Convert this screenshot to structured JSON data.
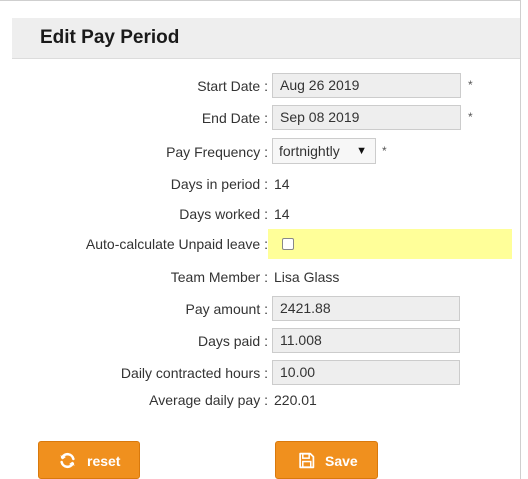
{
  "form": {
    "title": "Edit Pay Period",
    "start_date": {
      "label": "Start Date :",
      "value": "Aug 26 2019",
      "required": "*"
    },
    "end_date": {
      "label": "End Date :",
      "value": "Sep 08 2019",
      "required": "*"
    },
    "pay_frequency": {
      "label": "Pay Frequency :",
      "selected": "fortnightly",
      "required": "*"
    },
    "days_in_period": {
      "label": "Days in period :",
      "value": "14"
    },
    "days_worked": {
      "label": "Days worked :",
      "value": "14"
    },
    "auto_calculate": {
      "label": "Auto-calculate Unpaid leave :",
      "checked": false
    },
    "team_member": {
      "label": "Team Member :",
      "value": "Lisa Glass"
    },
    "pay_amount": {
      "label": "Pay amount :",
      "value": "2421.88"
    },
    "days_paid": {
      "label": "Days paid :",
      "value": "11.008"
    },
    "daily_hours": {
      "label": "Daily contracted hours :",
      "value": "10.00"
    },
    "average_daily_pay": {
      "label": "Average daily pay :",
      "value": "220.01"
    }
  },
  "buttons": {
    "reset_label": "reset",
    "save_label": "Save"
  },
  "colors": {
    "button_bg": "#f0901e",
    "highlight_bg": "#ffff99",
    "header_bg": "#eeeeee"
  },
  "icons": {
    "reset": "refresh-icon",
    "save": "floppy-disk-icon"
  }
}
